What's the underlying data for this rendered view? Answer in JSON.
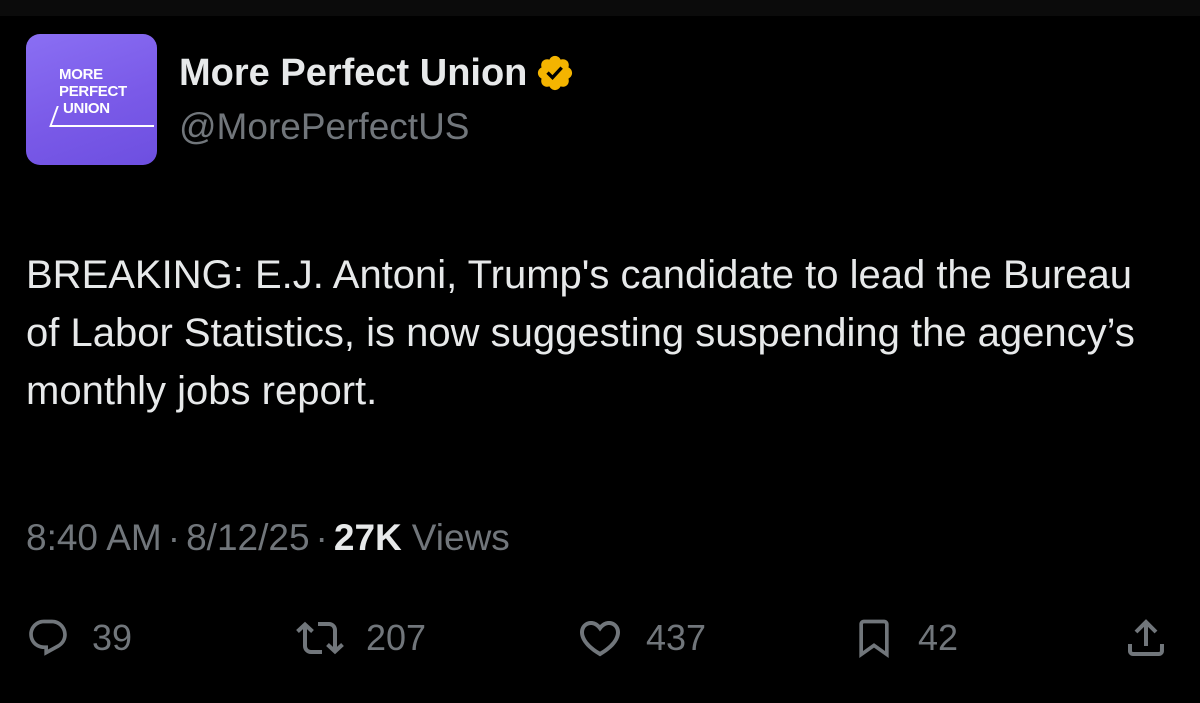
{
  "author": {
    "display_name": "More Perfect Union",
    "handle": "@MorePerfectUS",
    "avatar_logo_lines": [
      "MORE",
      "PERFECT",
      "UNION"
    ],
    "verified": true,
    "verified_color": "#f4b400",
    "avatar_color": "#7a5ae8"
  },
  "tweet": {
    "text": "BREAKING: E.J. Antoni, Trump's candidate to lead the Bureau of Labor Statistics, is now suggesting suspending the agency’s monthly jobs report."
  },
  "meta": {
    "time": "8:40 AM",
    "separator": "·",
    "date": "8/12/25",
    "views_count": "27K",
    "views_label": "Views"
  },
  "actions": {
    "reply": {
      "icon": "reply-icon",
      "count": "39"
    },
    "repost": {
      "icon": "repost-icon",
      "count": "207"
    },
    "like": {
      "icon": "heart-icon",
      "count": "437"
    },
    "bookmark": {
      "icon": "bookmark-icon",
      "count": "42"
    },
    "share": {
      "icon": "share-icon"
    }
  },
  "colors": {
    "background": "#000000",
    "primary_text": "#e7e9ea",
    "secondary_text": "#71767b"
  }
}
